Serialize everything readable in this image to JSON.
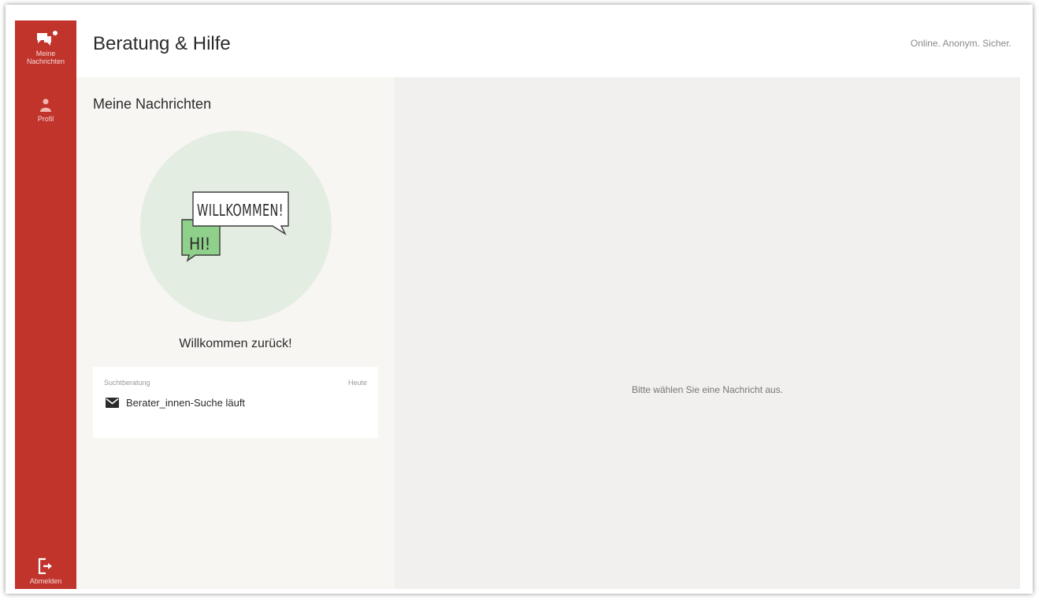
{
  "sidebar": {
    "items": [
      {
        "label_line1": "Meine",
        "label_line2": "Nachrichten",
        "icon": "chat-bubbles-icon"
      },
      {
        "label": "Profil",
        "icon": "user-icon"
      }
    ],
    "logout": {
      "label": "Abmelden",
      "icon": "logout-icon"
    }
  },
  "header": {
    "title": "Beratung & Hilfe",
    "tagline": "Online. Anonym. Sicher."
  },
  "list": {
    "title": "Meine Nachrichten",
    "illustration": {
      "bubble_main": "WILLKOMMEN!",
      "bubble_small": "HI!"
    },
    "welcome": "Willkommen zurück!",
    "sessions": [
      {
        "topic": "Suchtberatung",
        "date": "Heute",
        "status": "Berater_innen-Suche läuft",
        "icon": "envelope-icon"
      }
    ]
  },
  "detail": {
    "empty_message": "Bitte wählen Sie eine Nachricht aus."
  },
  "colors": {
    "brand": "#c0342c",
    "illustration_circle": "#e4ede1",
    "bubble_green": "#8fd08a"
  }
}
